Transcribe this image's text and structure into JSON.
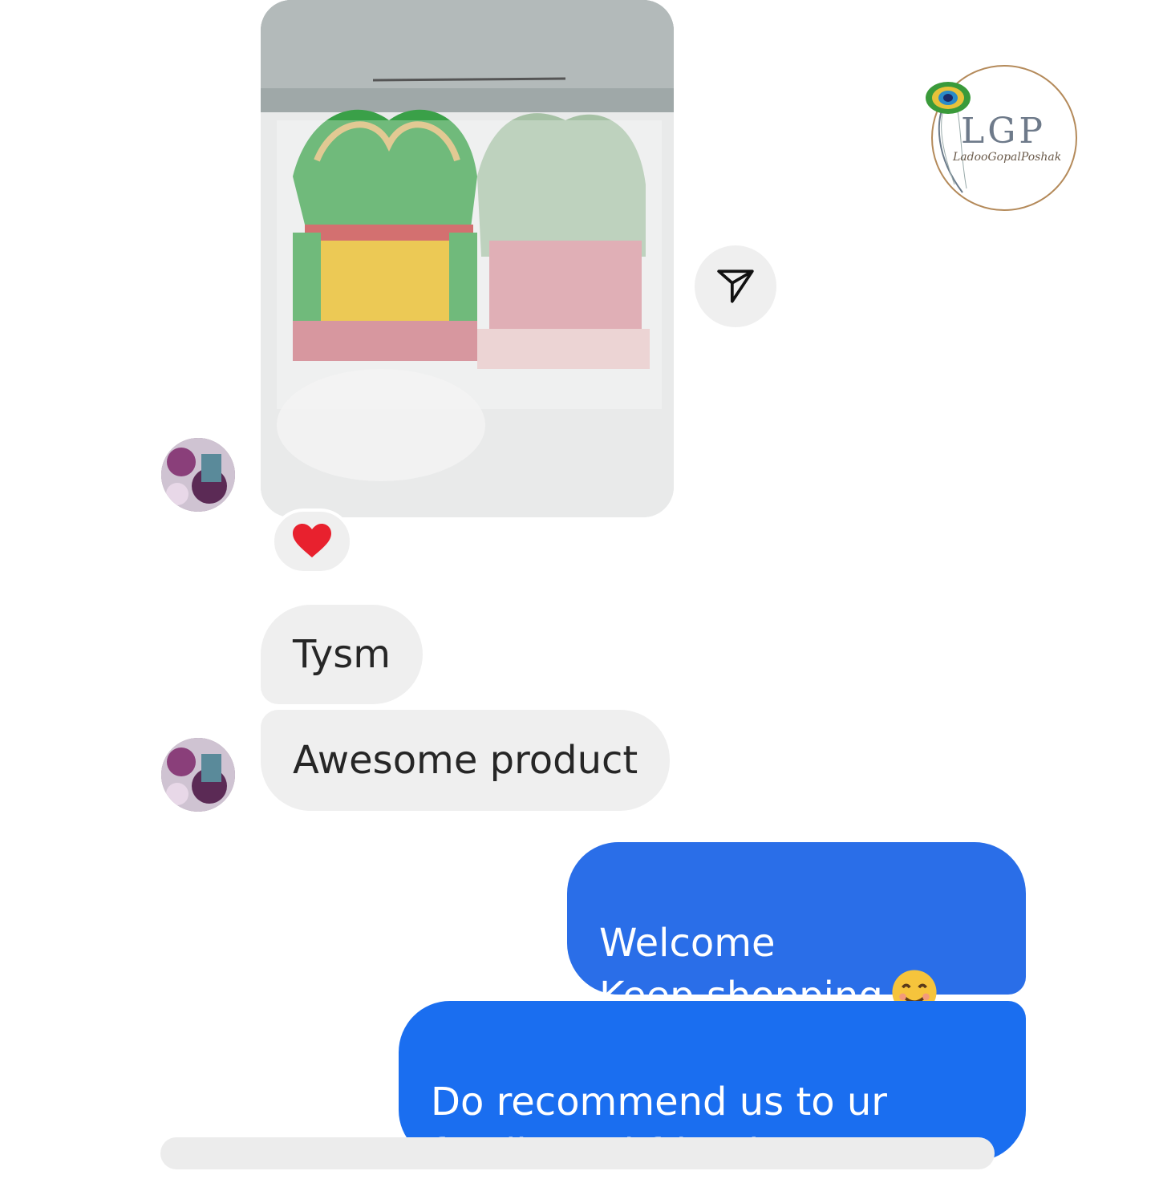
{
  "logo": {
    "initials": "LGP",
    "script_text": "LadooGopalPoshak"
  },
  "messages": {
    "received": [
      {
        "text": "Tysm"
      },
      {
        "text": "Awesome product"
      }
    ],
    "sent": [
      {
        "text": "Welcome\nKeep shopping"
      },
      {
        "text": "Do recommend us to ur family and friends"
      }
    ]
  },
  "icons": {
    "share": "paper-plane-icon",
    "reaction": "heart-icon",
    "emoji_1": "smiling-face-icon",
    "emoji_2": "folded-hands-icon"
  },
  "colors": {
    "sent_bubble": "#2a6ee8",
    "received_bubble": "#efefef",
    "heart": "#e8212e"
  }
}
